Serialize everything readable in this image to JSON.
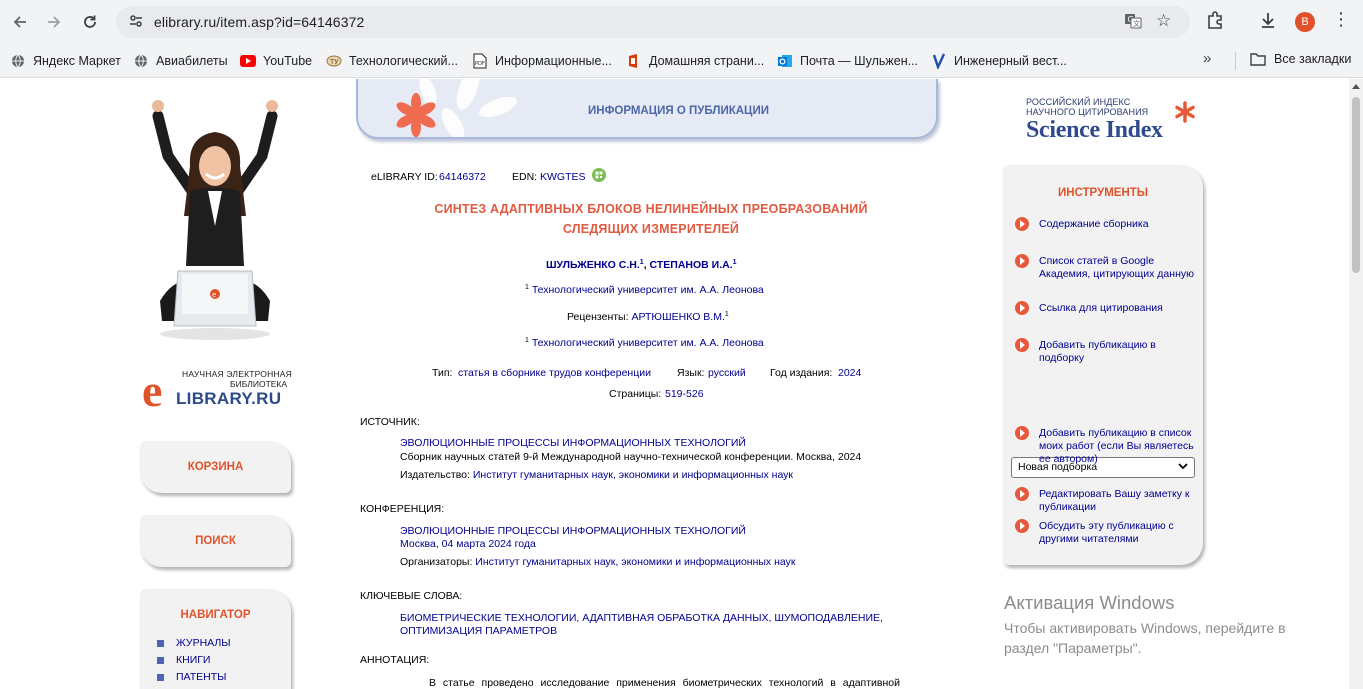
{
  "browser": {
    "url": "elibrary.ru/item.asp?id=64146372",
    "profile_letter": "В",
    "bookmarks": [
      {
        "label": "Яндекс Маркет",
        "icon": "globe-icon"
      },
      {
        "label": "Авиабилеты",
        "icon": "globe-icon"
      },
      {
        "label": "YouTube",
        "icon": "youtube-icon"
      },
      {
        "label": "Технологический...",
        "icon": "university-icon"
      },
      {
        "label": "Информационные...",
        "icon": "pdf-icon"
      },
      {
        "label": "Домашняя страни...",
        "icon": "office-icon"
      },
      {
        "label": "Почта — Шульжен...",
        "icon": "outlook-icon"
      },
      {
        "label": "Инженерный вест...",
        "icon": "journal-icon"
      }
    ],
    "all_bookmarks": "Все закладки"
  },
  "left": {
    "logo_line1": "НАУЧНАЯ ЭЛЕКТРОННАЯ",
    "logo_line2": "БИБЛИОТЕКА",
    "logo_main": "LIBRARY.RU",
    "logo_e": "e",
    "basket": "КОРЗИНА",
    "search": "ПОИСК",
    "navigator": "НАВИГАТОР",
    "nav_items": [
      "ЖУРНАЛЫ",
      "КНИГИ",
      "ПАТЕНТЫ"
    ]
  },
  "center": {
    "banner": "ИНФОРМАЦИЯ О ПУБЛИКАЦИИ",
    "elib_id_label": "eLIBRARY ID:",
    "elib_id": "64146372",
    "edn_label": "EDN:",
    "edn": "KWGTES",
    "title_line1": "СИНТЕЗ АДАПТИВНЫХ БЛОКОВ НЕЛИНЕЙНЫХ ПРЕОБРАЗОВАНИЙ",
    "title_line2": "СЛЕДЯЩИХ ИЗМЕРИТЕЛЕЙ",
    "author1": "ШУЛЬЖЕНКО С.Н.",
    "author2": "СТЕПАНОВ И.А.",
    "sup": "1",
    "affiliation": "Технологический университет им. А.А. Леонова",
    "reviewers_label": "Рецензенты:",
    "reviewer": "АРТЮШЕНКО В.М.",
    "type_label": "Тип:",
    "type": "статья в сборнике трудов конференции",
    "lang_label": "Язык:",
    "lang": "русский",
    "year_label": "Год издания:",
    "year": "2024",
    "pages_label": "Страницы:",
    "pages": "519-526",
    "source_label": "ИСТОЧНИК:",
    "source_title": "ЭВОЛЮЦИОННЫЕ ПРОЦЕССЫ ИНФОРМАЦИОННЫХ ТЕХНОЛОГИЙ",
    "source_desc": "Сборник научных статей 9-й Международной научно-технической конференции. Москва, 2024",
    "publisher_label": "Издательство:",
    "publisher": "Институт гуманитарных наук, экономики и информационных наук",
    "conf_label": "КОНФЕРЕНЦИЯ:",
    "conf_title": "ЭВОЛЮЦИОННЫЕ ПРОЦЕССЫ ИНФОРМАЦИОННЫХ ТЕХНОЛОГИЙ",
    "conf_place": "Москва, 04 марта 2024 года",
    "organizers_label": "Организаторы:",
    "organizers": "Институт гуманитарных наук, экономики и информационных наук",
    "keywords_label": "КЛЮЧЕВЫЕ СЛОВА:",
    "keywords_line1": "БИОМЕТРИЧЕСКИЕ ТЕХНОЛОГИИ, АДАПТИВНАЯ ОБРАБОТКА ДАННЫХ, ШУМОПОДАВЛЕНИЕ,",
    "keywords_line2": "ОПТИМИЗАЦИЯ ПАРАМЕТРОВ",
    "abstract_label": "АННОТАЦИЯ:",
    "abstract_start": "В статье проведено исследование применения биометрических технологий в адаптивной"
  },
  "right": {
    "sci_line1": "РОССИЙСКИЙ ИНДЕКС",
    "sci_line2": "НАУЧНОГО ЦИТИРОВАНИЯ",
    "sci_main": "Science Index",
    "tools_title": "ИНСТРУМЕНТЫ",
    "tools": [
      "Содержание сборника",
      "Список статей в Google Академия, цитирующих данную",
      "Ссылка для цитирования",
      "Добавить публикацию в подборку",
      "Добавить публикацию в список моих работ (если Вы являетесь ее автором)",
      "Редактировать Вашу заметку к публикации",
      "Обсудить эту публикацию с другими читателями"
    ],
    "select_value": "Новая подборка"
  },
  "watermark": {
    "line1": "Активация Windows",
    "line2": "Чтобы активировать Windows, перейдите в",
    "line3": "раздел \"Параметры\"."
  },
  "colors": {
    "accent_red": "#e0542c",
    "link_blue": "#00008f",
    "banner_blue": "#4d67a8",
    "panel_gray": "#f2f2f2"
  }
}
